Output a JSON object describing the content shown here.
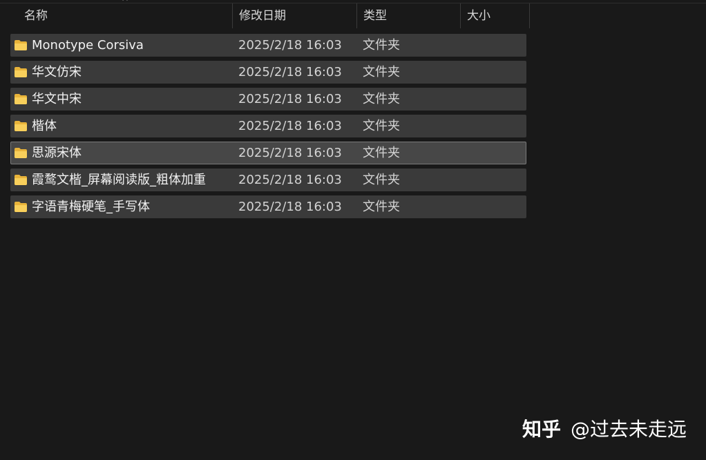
{
  "columns": {
    "name": "名称",
    "date": "修改日期",
    "type": "类型",
    "size": "大小",
    "sort_indicator": "^"
  },
  "colors": {
    "background": "#191919",
    "row": "#3a3a3a",
    "row_selected": "#474747",
    "folder": "#f5c54a"
  },
  "rows": [
    {
      "name": "Monotype Corsiva",
      "date": "2025/2/18 16:03",
      "type": "文件夹",
      "icon": "folder-icon"
    },
    {
      "name": "华文仿宋",
      "date": "2025/2/18 16:03",
      "type": "文件夹",
      "icon": "folder-icon"
    },
    {
      "name": "华文中宋",
      "date": "2025/2/18 16:03",
      "type": "文件夹",
      "icon": "folder-icon"
    },
    {
      "name": "楷体",
      "date": "2025/2/18 16:03",
      "type": "文件夹",
      "icon": "folder-icon"
    },
    {
      "name": "思源宋体",
      "date": "2025/2/18 16:03",
      "type": "文件夹",
      "icon": "folder-icon",
      "selected": true
    },
    {
      "name": "霞鹜文楷_屏幕阅读版_粗体加重",
      "date": "2025/2/18 16:03",
      "type": "文件夹",
      "icon": "folder-icon"
    },
    {
      "name": "字语青梅硬笔_手写体",
      "date": "2025/2/18 16:03",
      "type": "文件夹",
      "icon": "folder-icon"
    }
  ],
  "watermark": {
    "brand": "知乎",
    "author": "@过去未走远"
  }
}
